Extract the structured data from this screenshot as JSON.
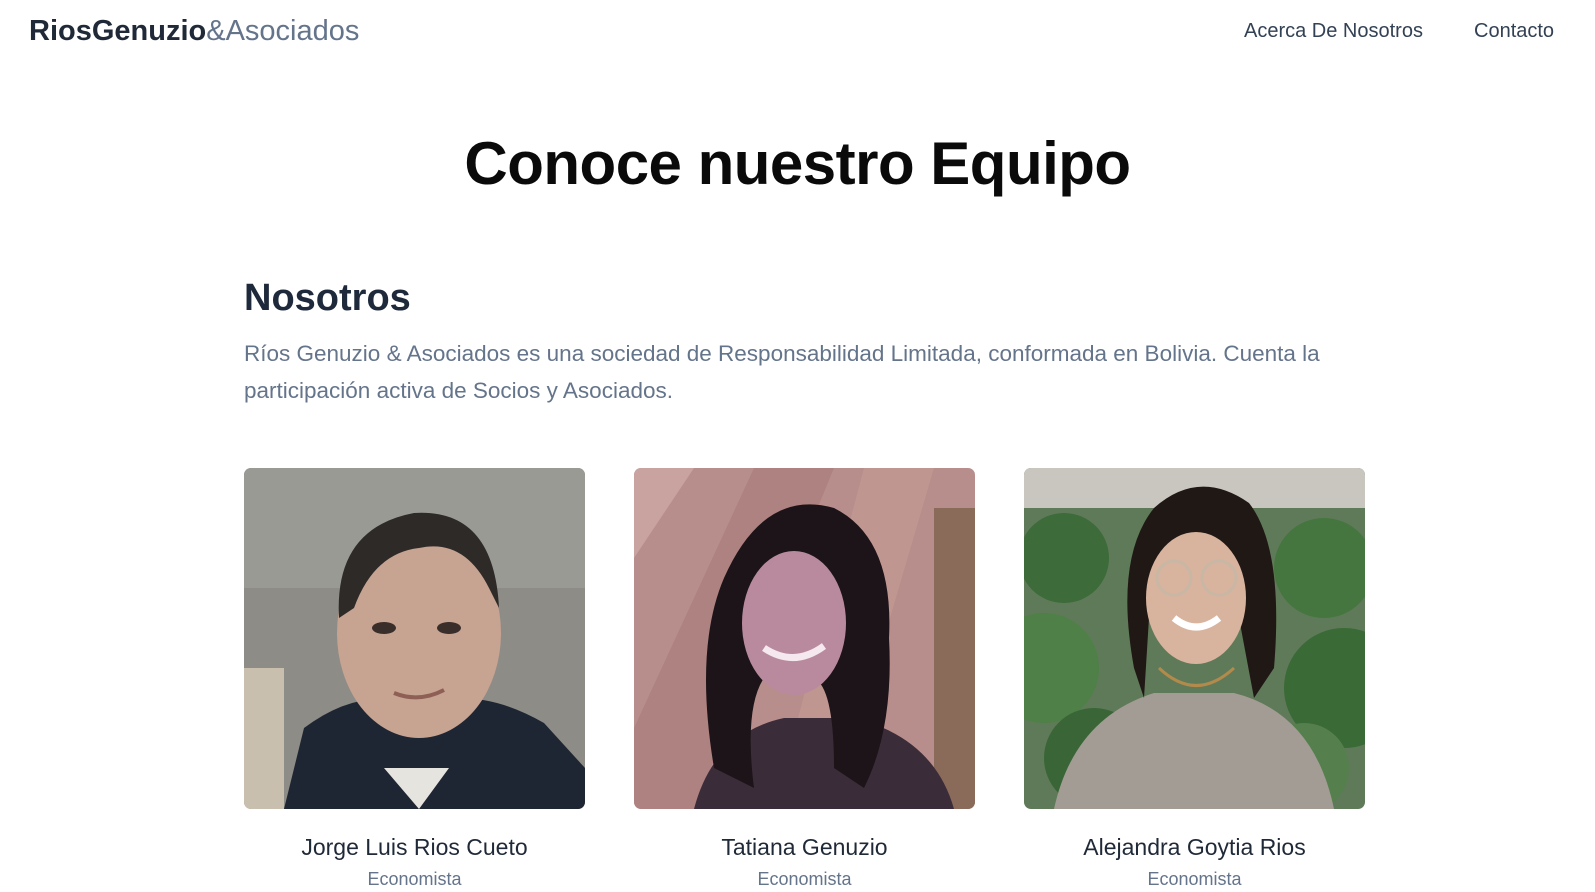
{
  "navbar": {
    "brand_bold": "RiosGenuzio",
    "brand_light": "&Asociados",
    "links": [
      {
        "label": "Acerca De Nosotros"
      },
      {
        "label": "Contacto"
      }
    ]
  },
  "hero": {
    "title": "Conoce nuestro Equipo"
  },
  "about": {
    "title": "Nosotros",
    "text": "Ríos Genuzio & Asociados es una sociedad de Responsabilidad Limitada, conformada en Bolivia. Cuenta la participación activa de Socios y Asociados."
  },
  "team": [
    {
      "name": "Jorge Luis Rios Cueto",
      "role": "Economista"
    },
    {
      "name": "Tatiana Genuzio",
      "role": "Economista"
    },
    {
      "name": "Alejandra Goytia Rios",
      "role": "Economista"
    }
  ]
}
